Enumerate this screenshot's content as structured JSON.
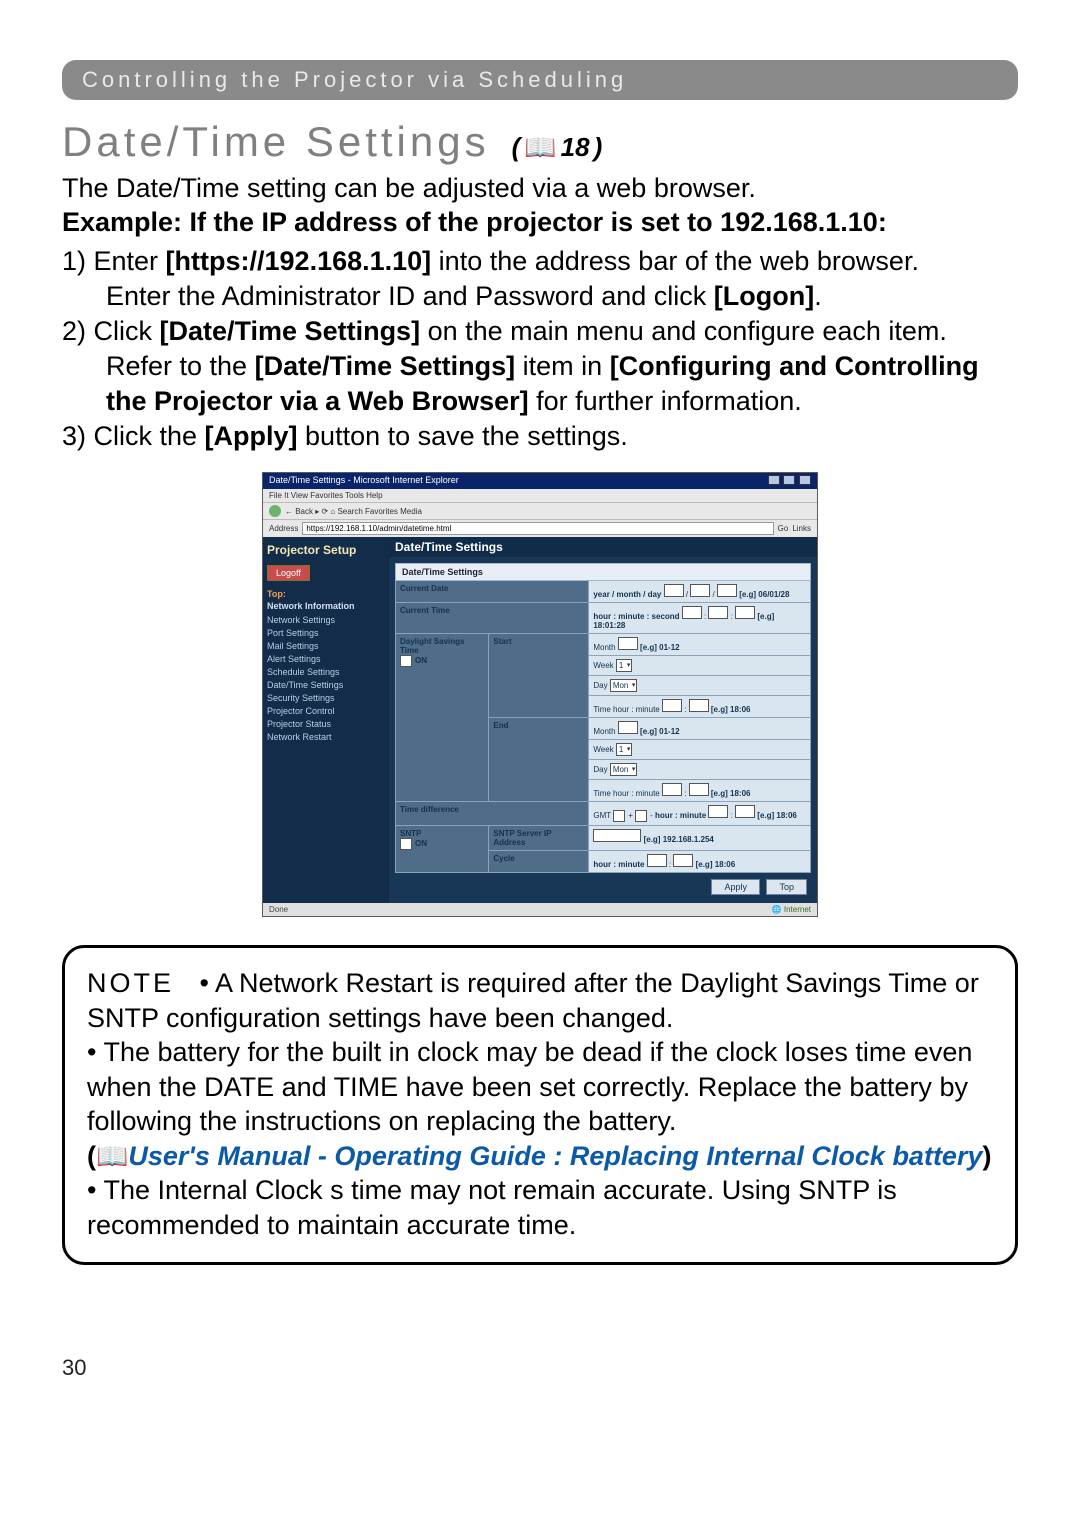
{
  "breadcrumb": "Controlling the Projector via Scheduling",
  "title": "Date/Time Settings",
  "pageRef": "18",
  "intro": {
    "line1": "The Date/Time setting can be adjusted via a web browser.",
    "line2_prefix": "Example: If the IP address of the projector is set to ",
    "line2_ip": "192.168.1.10:"
  },
  "steps": {
    "s1a": "1) Enter ",
    "s1b": "[https://192.168.1.10]",
    "s1c": " into the address bar of the web browser.",
    "s1d": "Enter the Administrator ID and Password and click ",
    "s1e": "[Logon]",
    "s1f": ".",
    "s2a": "2) Click ",
    "s2b": "[Date/Time Settings]",
    "s2c": " on the main menu and configure each item.",
    "s2d": "Refer to the ",
    "s2e": "[Date/Time Settings]",
    "s2f": " item in ",
    "s2g": "[Configuring and Controlling the Projector via a Web Browser]",
    "s2h": " for further information.",
    "s3a": "3) Click the ",
    "s3b": "[Apply]",
    "s3c": " button to save the settings."
  },
  "shot": {
    "windowTitle": "Date/Time Settings - Microsoft Internet Explorer",
    "menu": "File  It  View  Favorites  Tools  Help",
    "toolbar": " ← Back  ▸  ⟳  ⌂  Search  Favorites  Media",
    "addrLabel": "Address",
    "addrValue": "https://192.168.1.10/admin/datetime.html",
    "goLabel": "Go",
    "linksLabel": "Links",
    "side": {
      "logo": "Projector Setup",
      "logoff": "Logoff",
      "top": "Top:",
      "netinfo": "Network Information",
      "items": [
        "Network Settings",
        "Port Settings",
        "Mail Settings",
        "Alert Settings",
        "Schedule Settings",
        "Date/Time Settings",
        "Security Settings",
        "Projector Control",
        "Projector Status",
        "Network Restart"
      ]
    },
    "main": {
      "title": "Date/Time Settings",
      "tableHeader": "Date/Time Settings",
      "rowCurrentDate": {
        "label": "Current Date",
        "text": "year / month / day",
        "eg": "[e.g] 06/01/28"
      },
      "rowCurrentTime": {
        "label": "Current Time",
        "text": "hour : minute : second",
        "eg": "[e.g] 18:01:28"
      },
      "dst": {
        "group": "Daylight Savings Time",
        "on": "ON",
        "start": "Start",
        "end": "End",
        "month": "Month",
        "monthEg": "[e.g] 01-12",
        "week": "Week",
        "day": "Day",
        "timeLabel": "Time hour : minute",
        "timeEg": "[e.g] 18:06"
      },
      "timediff": {
        "label": "Time difference",
        "gmt": "GMT",
        "plus": "+",
        "minus": "-",
        "text": "hour : minute",
        "eg": "[e.g] 18:06"
      },
      "sntp": {
        "group": "SNTP",
        "on": "ON",
        "ipLabel": "SNTP Server IP Address",
        "ipEg": "[e.g] 192.168.1.254",
        "cycleLabel": "Cycle",
        "cycleText": "hour : minute",
        "cycleEg": "[e.g] 18:06"
      },
      "apply": "Apply",
      "top": "Top"
    },
    "status": {
      "done": "Done",
      "internet": "Internet"
    }
  },
  "note": {
    "label": "NOTE",
    "bullet": "•",
    "p1": " A Network Restart is required after the Daylight Savings Time or SNTP configuration settings have been changed.",
    "p2": " The battery for the built in clock may be dead if the clock loses time even when the DATE and TIME have been set correctly. Replace the battery by following the instructions on replacing the battery.",
    "linkPrefix": "(",
    "linkText": "User's Manual - Operating Guide : Replacing Internal Clock battery",
    "linkSuffix": ")",
    "p3": " The Internal Clock s time may not remain accurate. Using SNTP is recommended to maintain accurate time."
  },
  "pageNumber": "30"
}
